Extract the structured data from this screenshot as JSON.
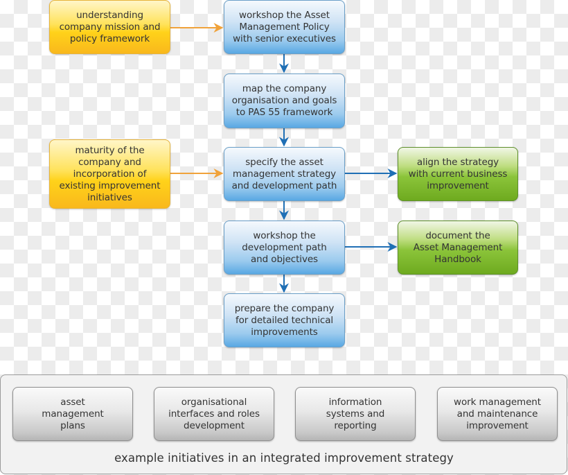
{
  "diagram": {
    "inputs": [
      {
        "id": "understanding",
        "text": "understanding company mission and policy framework",
        "lines": [
          "understanding",
          "company mission and",
          "policy framework"
        ],
        "color": "yellow"
      },
      {
        "id": "maturity",
        "text": "maturity of the company and incorporation of existing improvement initiatives",
        "lines": [
          "maturity of the",
          "company and",
          "incorporation of",
          "existing improvement",
          "initiatives"
        ],
        "color": "yellow"
      }
    ],
    "steps": [
      {
        "id": "workshop-policy",
        "lines": [
          "workshop the Asset",
          "Management Policy",
          "with senior executives"
        ],
        "color": "blue"
      },
      {
        "id": "map-company",
        "lines": [
          "map the company",
          "organisation and goals",
          "to PAS 55 framework"
        ],
        "color": "blue"
      },
      {
        "id": "specify-strategy",
        "lines": [
          "specify the asset",
          "management strategy",
          "and development path"
        ],
        "color": "blue"
      },
      {
        "id": "workshop-path",
        "lines": [
          "workshop the",
          "development path",
          "and objectives"
        ],
        "color": "blue"
      },
      {
        "id": "prepare-company",
        "lines": [
          "prepare the company",
          "for detailed technical",
          "improvements"
        ],
        "color": "blue"
      }
    ],
    "outputs": [
      {
        "id": "align-strategy",
        "lines": [
          "align the strategy",
          "with current business",
          "improvement"
        ],
        "color": "green"
      },
      {
        "id": "document-handbook",
        "lines": [
          "document the",
          "Asset Management",
          "Handbook"
        ],
        "color": "green"
      }
    ],
    "initiatives": {
      "caption": "example initiatives in an integrated improvement strategy",
      "items": [
        {
          "id": "asset-management-plans",
          "lines": [
            "asset",
            "management",
            "plans"
          ]
        },
        {
          "id": "organisational-interfaces",
          "lines": [
            "organisational",
            "interfaces and roles",
            "development"
          ]
        },
        {
          "id": "information-systems",
          "lines": [
            "information",
            "systems and",
            "reporting"
          ]
        },
        {
          "id": "work-management",
          "lines": [
            "work management",
            "and maintenance",
            "improvement"
          ]
        }
      ]
    },
    "edges": [
      {
        "from": "understanding",
        "to": "workshop-policy",
        "color": "orange"
      },
      {
        "from": "maturity",
        "to": "specify-strategy",
        "color": "orange"
      },
      {
        "from": "workshop-policy",
        "to": "map-company",
        "color": "blue"
      },
      {
        "from": "map-company",
        "to": "specify-strategy",
        "color": "blue"
      },
      {
        "from": "specify-strategy",
        "to": "workshop-path",
        "color": "blue"
      },
      {
        "from": "workshop-path",
        "to": "prepare-company",
        "color": "blue"
      },
      {
        "from": "specify-strategy",
        "to": "align-strategy",
        "color": "blue"
      },
      {
        "from": "workshop-path",
        "to": "document-handbook",
        "color": "blue"
      }
    ],
    "colors": {
      "orange_arrow": "#f0a23a",
      "blue_arrow": "#1f6fb5",
      "yellow": "#ffd21a",
      "blue": "#59a8e3",
      "green": "#6eaa1f",
      "grey": "#c9c9c9",
      "text": "#333333"
    }
  }
}
